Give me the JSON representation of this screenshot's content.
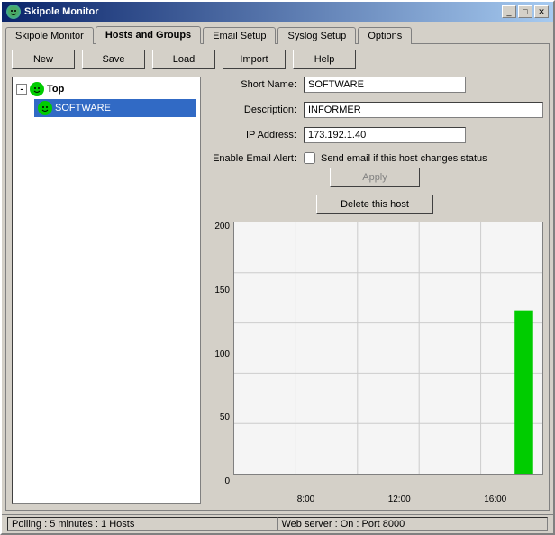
{
  "window": {
    "title": "Skipole Monitor",
    "title_icon": "●"
  },
  "title_buttons": {
    "minimize": "_",
    "maximize": "□",
    "close": "✕"
  },
  "tabs": [
    {
      "label": "Skipole Monitor",
      "active": false
    },
    {
      "label": "Hosts and Groups",
      "active": true
    },
    {
      "label": "Email Setup",
      "active": false
    },
    {
      "label": "Syslog Setup",
      "active": false
    },
    {
      "label": "Options",
      "active": false
    }
  ],
  "toolbar": {
    "new": "New",
    "save": "Save",
    "load": "Load",
    "import": "Import",
    "help": "Help"
  },
  "tree": {
    "top_label": "Top",
    "expand_symbol": "-",
    "child_label": "SOFTWARE"
  },
  "form": {
    "short_name_label": "Short Name:",
    "short_name_value": "SOFTWARE",
    "description_label": "Description:",
    "description_value": "INFORMER",
    "ip_label": "IP Address:",
    "ip_value": "173.192.1.40",
    "email_label": "Enable Email Alert:",
    "email_checkbox_label": "Send email if this host changes status",
    "email_checked": false
  },
  "actions": {
    "apply": "Apply",
    "delete": "Delete this host"
  },
  "chart": {
    "y_labels": [
      "0",
      "50",
      "100",
      "150",
      "200"
    ],
    "x_labels": [
      "8:00",
      "12:00",
      "16:00"
    ],
    "bar_height_percent": 65
  },
  "status": {
    "left": "Polling : 5 minutes : 1 Hosts",
    "right": "Web server : On : Port 8000"
  }
}
